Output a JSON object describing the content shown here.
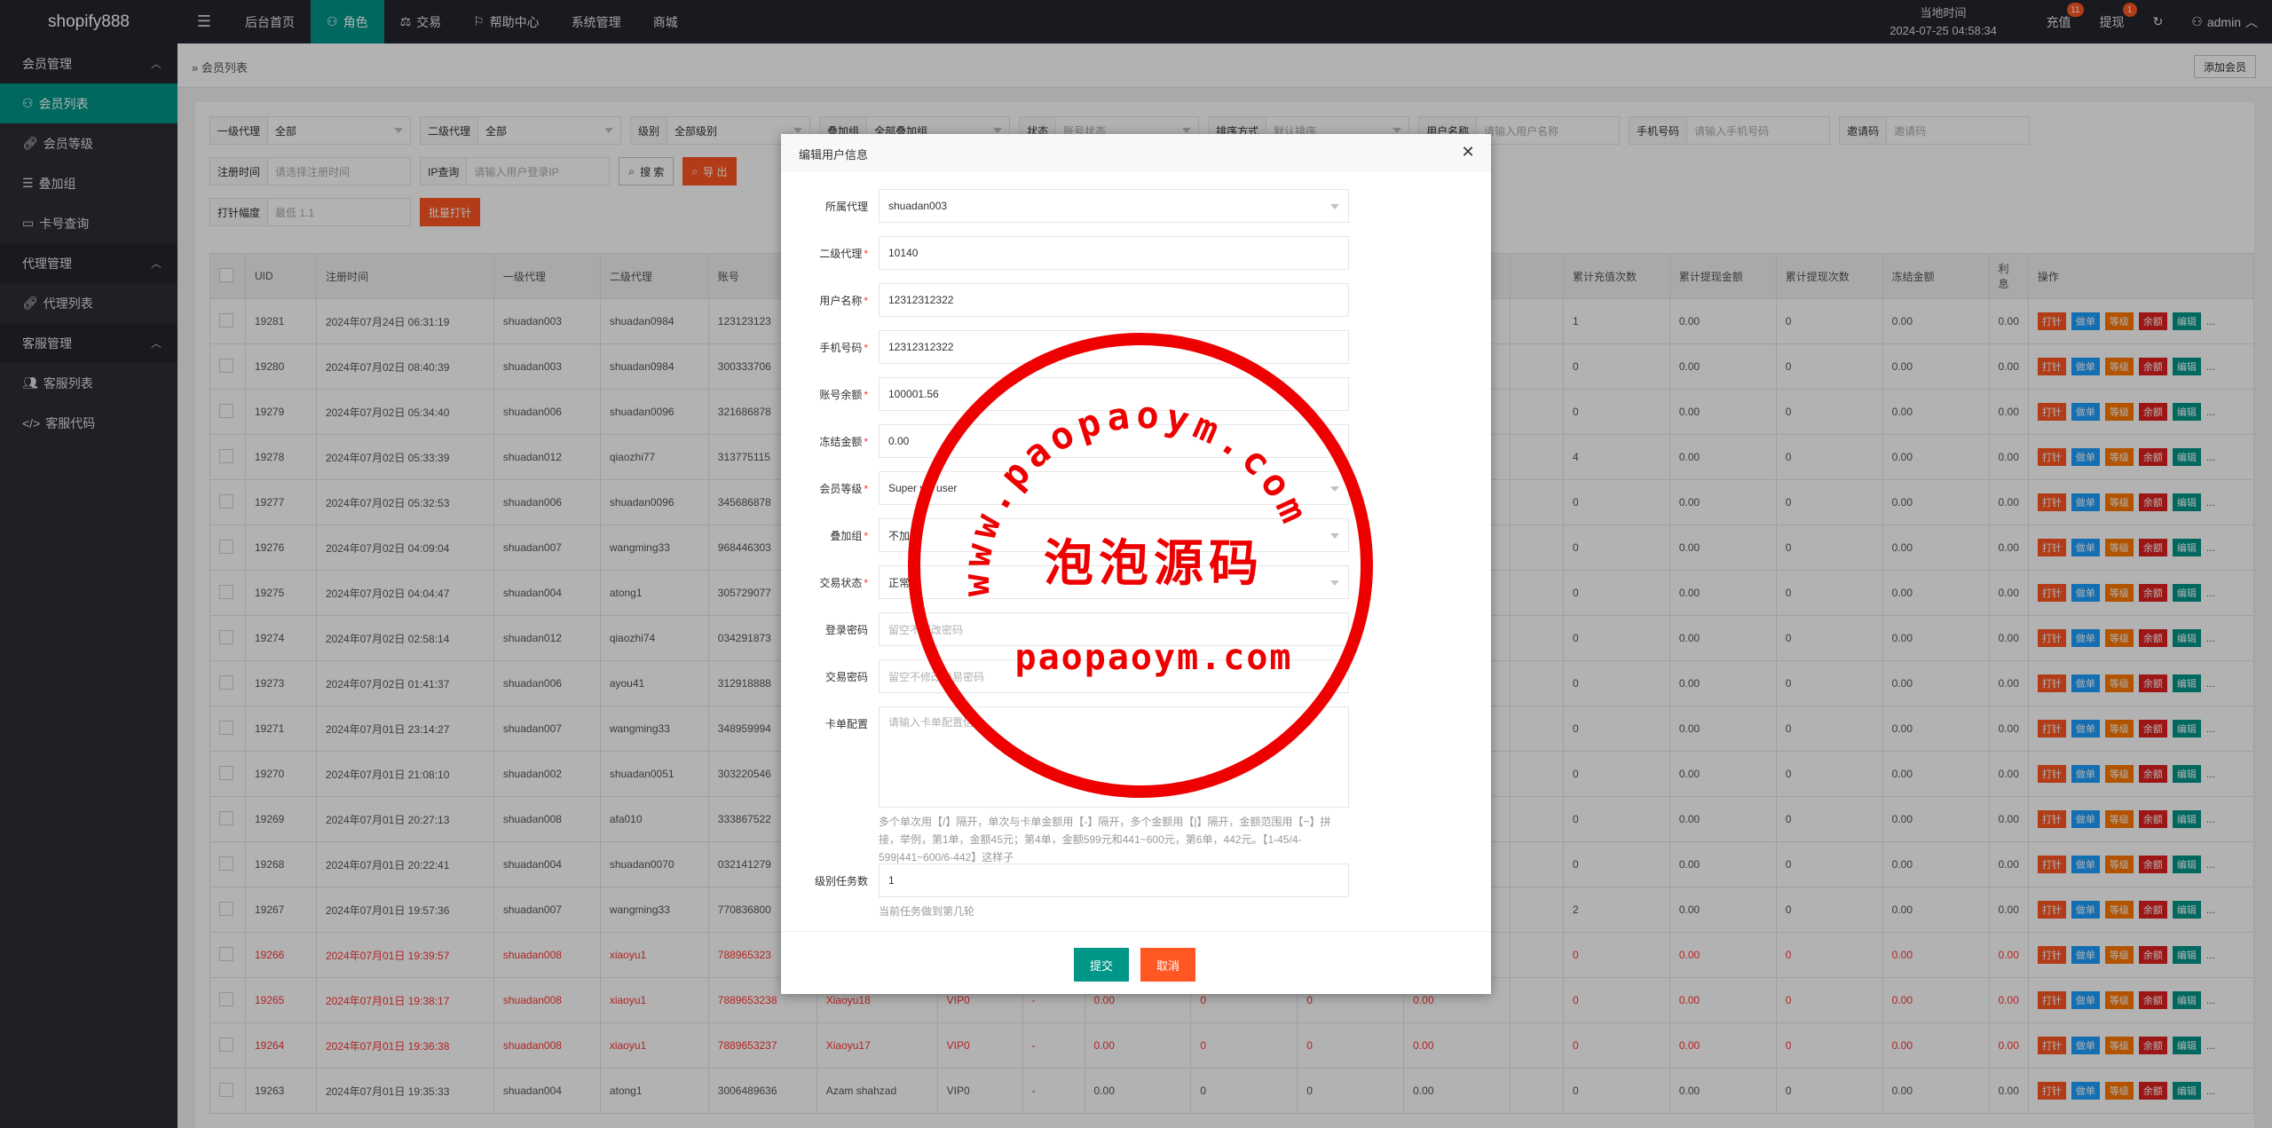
{
  "app": {
    "brand": "shopify888"
  },
  "topnav": [
    {
      "label": "后台首页",
      "icon": ""
    },
    {
      "label": "角色",
      "icon": "user-icon"
    },
    {
      "label": "交易",
      "icon": "scale-icon"
    },
    {
      "label": "帮助中心",
      "icon": "flag-icon"
    },
    {
      "label": "系统管理",
      "icon": ""
    },
    {
      "label": "商城",
      "icon": ""
    }
  ],
  "topright": {
    "clock_label": "当地时间",
    "clock_value": "2024-07-25 04:58:34",
    "recharge_label": "充值",
    "recharge_badge": "11",
    "withdraw_label": "提现",
    "withdraw_badge": "1",
    "user": "admin"
  },
  "sidebar": {
    "groups": [
      {
        "label": "会员管理",
        "items": [
          {
            "label": "会员列表",
            "icon": "user-icon",
            "active": true
          },
          {
            "label": "会员等级",
            "icon": "link-icon"
          },
          {
            "label": "叠加组",
            "icon": "list-icon"
          },
          {
            "label": "卡号查询",
            "icon": "card-icon"
          }
        ]
      },
      {
        "label": "代理管理",
        "items": [
          {
            "label": "代理列表",
            "icon": "link-icon"
          }
        ]
      },
      {
        "label": "客服管理",
        "items": [
          {
            "label": "客服列表",
            "icon": "users-icon"
          },
          {
            "label": "客服代码",
            "icon": "code-icon"
          }
        ]
      }
    ]
  },
  "breadcrumb": "会员列表",
  "add_member_label": "添加会员",
  "filters": {
    "row1": [
      {
        "label": "一级代理",
        "value": "全部",
        "select": true
      },
      {
        "label": "二级代理",
        "value": "全部",
        "select": true
      },
      {
        "label": "级别",
        "value": "全部级别",
        "select": true
      },
      {
        "label": "叠加组",
        "value": "全部叠加组",
        "select": true
      },
      {
        "label": "状态",
        "value": "账号状态",
        "select": true
      },
      {
        "label": "排序方式",
        "value": "默认排序",
        "select": true
      },
      {
        "label": "用户名称",
        "value": "请输入用户名称",
        "placeholder": true
      },
      {
        "label": "手机号码",
        "value": "请输入手机号码",
        "placeholder": true
      },
      {
        "label": "邀请码",
        "value": "邀请码",
        "placeholder": true
      }
    ],
    "row2": [
      {
        "label": "注册时间",
        "value": "请选择注册时间",
        "placeholder": true
      },
      {
        "label": "IP查询",
        "value": "请输入用户登录IP",
        "placeholder": true
      }
    ],
    "search_label": "搜 索",
    "export_label": "导 出",
    "row3": [
      {
        "label": "打针幅度",
        "value": "最低 1.1",
        "placeholder": true
      }
    ],
    "batch_label": "批量打针"
  },
  "table": {
    "columns": [
      "UID",
      "注册时间",
      "一级代理",
      "二级代理",
      "账号",
      "",
      "",
      "",
      "",
      "",
      "",
      "",
      "",
      "累计充值次数",
      "累计提现金额",
      "累计提现次数",
      "冻结金额",
      "利息",
      "操作"
    ],
    "rows": [
      {
        "uid": "19281",
        "time": "2024年07月24日 06:31:19",
        "a1": "shuadan003",
        "a2": "shuadan0984",
        "acct": "123123123",
        "mid": [
          "",
          "",
          "",
          "",
          "",
          "",
          "",
          ""
        ],
        "rc": "1",
        "wa": "0.00",
        "wc": "0",
        "fz": "0.00",
        "it": "0.00",
        "red": false
      },
      {
        "uid": "19280",
        "time": "2024年07月02日 08:40:39",
        "a1": "shuadan003",
        "a2": "shuadan0984",
        "acct": "300333706",
        "mid": [
          "",
          "",
          "",
          "",
          "",
          "",
          "",
          ""
        ],
        "rc": "0",
        "wa": "0.00",
        "wc": "0",
        "fz": "0.00",
        "it": "0.00",
        "red": false
      },
      {
        "uid": "19279",
        "time": "2024年07月02日 05:34:40",
        "a1": "shuadan006",
        "a2": "shuadan0096",
        "acct": "321686878",
        "mid": [
          "",
          "",
          "",
          "",
          "",
          "",
          "",
          ""
        ],
        "rc": "0",
        "wa": "0.00",
        "wc": "0",
        "fz": "0.00",
        "it": "0.00",
        "red": false
      },
      {
        "uid": "19278",
        "time": "2024年07月02日 05:33:39",
        "a1": "shuadan012",
        "a2": "qiaozhi77",
        "acct": "313775115",
        "mid": [
          "",
          "",
          "",
          "",
          "",
          "",
          "",
          ""
        ],
        "rc": "4",
        "wa": "0.00",
        "wc": "0",
        "fz": "0.00",
        "it": "0.00",
        "red": false
      },
      {
        "uid": "19277",
        "time": "2024年07月02日 05:32:53",
        "a1": "shuadan006",
        "a2": "shuadan0096",
        "acct": "345686878",
        "mid": [
          "",
          "",
          "",
          "",
          "",
          "",
          "",
          ""
        ],
        "rc": "0",
        "wa": "0.00",
        "wc": "0",
        "fz": "0.00",
        "it": "0.00",
        "red": false
      },
      {
        "uid": "19276",
        "time": "2024年07月02日 04:09:04",
        "a1": "shuadan007",
        "a2": "wangming33",
        "acct": "968446303",
        "mid": [
          "",
          "",
          "",
          "",
          "",
          "",
          "",
          ""
        ],
        "rc": "0",
        "wa": "0.00",
        "wc": "0",
        "fz": "0.00",
        "it": "0.00",
        "red": false
      },
      {
        "uid": "19275",
        "time": "2024年07月02日 04:04:47",
        "a1": "shuadan004",
        "a2": "atong1",
        "acct": "305729077",
        "mid": [
          "",
          "",
          "",
          "",
          "",
          "",
          "",
          ""
        ],
        "rc": "0",
        "wa": "0.00",
        "wc": "0",
        "fz": "0.00",
        "it": "0.00",
        "red": false
      },
      {
        "uid": "19274",
        "time": "2024年07月02日 02:58:14",
        "a1": "shuadan012",
        "a2": "qiaozhi74",
        "acct": "034291873",
        "mid": [
          "",
          "",
          "",
          "",
          "",
          "",
          "",
          ""
        ],
        "rc": "0",
        "wa": "0.00",
        "wc": "0",
        "fz": "0.00",
        "it": "0.00",
        "red": false
      },
      {
        "uid": "19273",
        "time": "2024年07月02日 01:41:37",
        "a1": "shuadan006",
        "a2": "ayou41",
        "acct": "312918888",
        "mid": [
          "",
          "",
          "",
          "",
          "",
          "",
          "",
          ""
        ],
        "rc": "0",
        "wa": "0.00",
        "wc": "0",
        "fz": "0.00",
        "it": "0.00",
        "red": false
      },
      {
        "uid": "19271",
        "time": "2024年07月01日 23:14:27",
        "a1": "shuadan007",
        "a2": "wangming33",
        "acct": "348959994",
        "mid": [
          "",
          "",
          "",
          "",
          "",
          "",
          "",
          ""
        ],
        "rc": "0",
        "wa": "0.00",
        "wc": "0",
        "fz": "0.00",
        "it": "0.00",
        "red": false
      },
      {
        "uid": "19270",
        "time": "2024年07月01日 21:08:10",
        "a1": "shuadan002",
        "a2": "shuadan0051",
        "acct": "303220546",
        "mid": [
          "",
          "",
          "",
          "",
          "",
          "",
          "",
          ""
        ],
        "rc": "0",
        "wa": "0.00",
        "wc": "0",
        "fz": "0.00",
        "it": "0.00",
        "red": false
      },
      {
        "uid": "19269",
        "time": "2024年07月01日 20:27:13",
        "a1": "shuadan008",
        "a2": "afa010",
        "acct": "333867522",
        "mid": [
          "",
          "",
          "",
          "",
          "",
          "",
          "",
          ""
        ],
        "rc": "0",
        "wa": "0.00",
        "wc": "0",
        "fz": "0.00",
        "it": "0.00",
        "red": false
      },
      {
        "uid": "19268",
        "time": "2024年07月01日 20:22:41",
        "a1": "shuadan004",
        "a2": "shuadan0070",
        "acct": "032141279",
        "mid": [
          "",
          "",
          "",
          "",
          "",
          "",
          "",
          ""
        ],
        "rc": "0",
        "wa": "0.00",
        "wc": "0",
        "fz": "0.00",
        "it": "0.00",
        "red": false
      },
      {
        "uid": "19267",
        "time": "2024年07月01日 19:57:36",
        "a1": "shuadan007",
        "a2": "wangming33",
        "acct": "770836800",
        "mid": [
          "",
          "",
          "",
          "",
          "",
          "",
          "",
          ""
        ],
        "rc": "2",
        "wa": "0.00",
        "wc": "0",
        "fz": "0.00",
        "it": "0.00",
        "red": false
      },
      {
        "uid": "19266",
        "time": "2024年07月01日 19:39:57",
        "a1": "shuadan008",
        "a2": "xiaoyu1",
        "acct": "788965323",
        "mid": [
          "",
          "",
          "",
          "",
          "",
          "",
          "",
          ""
        ],
        "rc": "0",
        "wa": "0.00",
        "wc": "0",
        "fz": "0.00",
        "it": "0.00",
        "red": true
      },
      {
        "uid": "19265",
        "time": "2024年07月01日 19:38:17",
        "a1": "shuadan008",
        "a2": "xiaoyu1",
        "acct": "7889653238",
        "mid": [
          "Xiaoyu18",
          "VIP0",
          "-",
          "0.00",
          "0",
          "0",
          "0.00",
          ""
        ],
        "rc": "0",
        "wa": "0.00",
        "wc": "0",
        "fz": "0.00",
        "it": "0.00",
        "red": true
      },
      {
        "uid": "19264",
        "time": "2024年07月01日 19:36:38",
        "a1": "shuadan008",
        "a2": "xiaoyu1",
        "acct": "7889653237",
        "mid": [
          "Xiaoyu17",
          "VIP0",
          "-",
          "0.00",
          "0",
          "0",
          "0.00",
          ""
        ],
        "rc": "0",
        "wa": "0.00",
        "wc": "0",
        "fz": "0.00",
        "it": "0.00",
        "red": true
      },
      {
        "uid": "19263",
        "time": "2024年07月01日 19:35:33",
        "a1": "shuadan004",
        "a2": "atong1",
        "acct": "3006489636",
        "mid": [
          "Azam shahzad",
          "VIP0",
          "-",
          "0.00",
          "0",
          "0",
          "0.00",
          ""
        ],
        "rc": "0",
        "wa": "0.00",
        "wc": "0",
        "fz": "0.00",
        "it": "0.00",
        "red": false
      }
    ],
    "ops": [
      "打针",
      "做单",
      "等级",
      "余额",
      "编辑",
      "..."
    ]
  },
  "modal": {
    "title": "编辑用户信息",
    "fields": [
      {
        "label": "所属代理",
        "value": "shuadan003",
        "required": false,
        "type": "select"
      },
      {
        "label": "二级代理",
        "value": "10140",
        "required": true,
        "type": "input"
      },
      {
        "label": "用户名称",
        "value": "12312312322",
        "required": true,
        "type": "input"
      },
      {
        "label": "手机号码",
        "value": "12312312322",
        "required": true,
        "type": "input"
      },
      {
        "label": "账号余额",
        "value": "100001.56",
        "required": true,
        "type": "input"
      },
      {
        "label": "冻结金额",
        "value": "0.00",
        "required": true,
        "type": "input"
      },
      {
        "label": "会员等级",
        "value": "Super vip user",
        "required": true,
        "type": "select"
      },
      {
        "label": "叠加组",
        "value": "不加入",
        "required": true,
        "type": "select"
      },
      {
        "label": "交易状态",
        "value": "正常",
        "required": true,
        "type": "select"
      },
      {
        "label": "登录密码",
        "value": "留空不修改密码",
        "required": false,
        "type": "placeholder"
      },
      {
        "label": "交易密码",
        "value": "留空不修改交易密码",
        "required": false,
        "type": "placeholder"
      }
    ],
    "card_label": "卡单配置",
    "card_placeholder": "请输入卡单配置信息",
    "card_hint": "多个单次用【/】隔开，单次与卡单金额用【-】隔开，多个金额用【|】隔开，金额范围用【~】拼接，举例，第1单，金额45元；第4单，金额599元和441~600元，第6单，442元。【1-45/4-599|441~600/6-442】这样子",
    "task_label": "级别任务数",
    "task_value": "1",
    "task_hint": "当前任务做到第几轮",
    "submit_label": "提交",
    "cancel_label": "取消"
  },
  "watermark": {
    "ring_text": "www.paopaoym.com",
    "main_text": "泡泡源码",
    "url_text": "paopaoym.com"
  }
}
